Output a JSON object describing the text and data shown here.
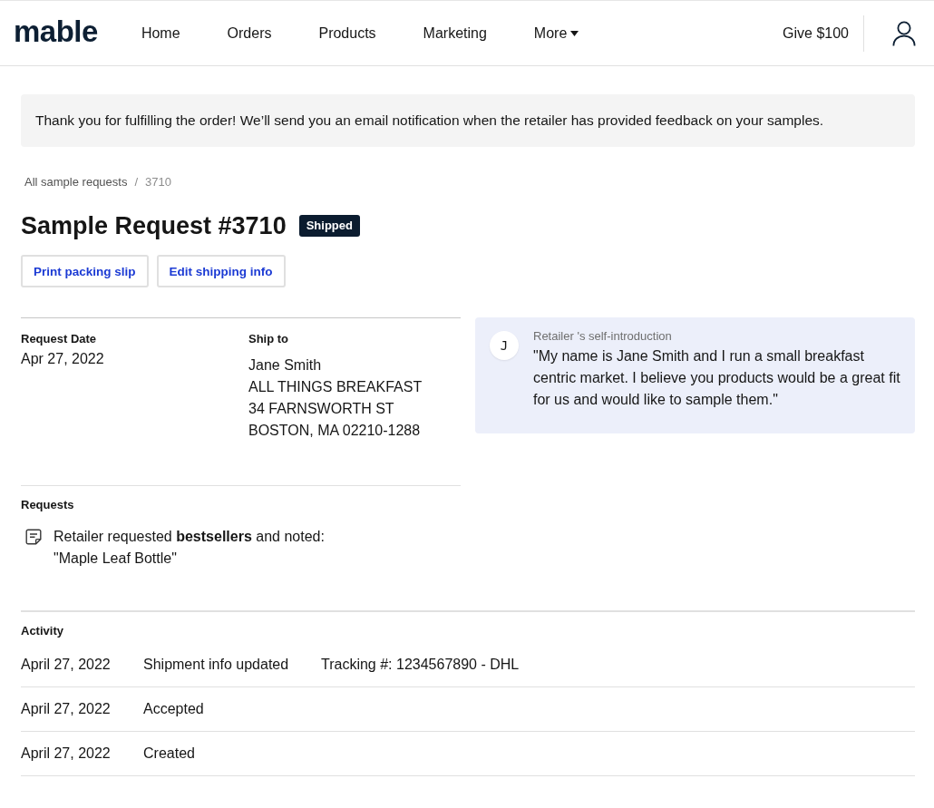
{
  "nav": {
    "logo": "mable",
    "items": [
      {
        "label": "Home",
        "kind": "link",
        "selected": false
      },
      {
        "label": "Orders",
        "kind": "link",
        "selected": false
      },
      {
        "label": "Products",
        "kind": "link",
        "selected": false
      },
      {
        "label": "Marketing",
        "kind": "link",
        "selected": false
      },
      {
        "label": "More",
        "kind": "dropdown",
        "selected": false
      }
    ],
    "give": "Give $100"
  },
  "banner": {
    "text": "Thank you for fulfilling the order! We’ll send you an email notification when the retailer has provided feedback on your samples."
  },
  "breadcrumb": {
    "items": [
      "All sample requests",
      "3710"
    ],
    "separator": "/"
  },
  "title": "Sample Request #3710",
  "status": {
    "label": "Shipped"
  },
  "actions": [
    "Print packing slip",
    "Edit shipping info"
  ],
  "details": {
    "request_date": {
      "label": "Request Date",
      "value": "Apr 27, 2022"
    },
    "ship_to": {
      "label": "Ship to",
      "lines": [
        "Jane Smith",
        "ALL THINGS BREAKFAST",
        "34 FARNSWORTH ST",
        "BOSTON, MA 02210-1288"
      ]
    }
  },
  "introduction": {
    "avatar": "J",
    "label": "Retailer 's self-introduction",
    "text": "\"My name is Jane Smith and I run a small breakfast centric market. I believe you products would be a great fit for us and would like to sample them.\""
  },
  "requests": {
    "label": "Requests",
    "text": "Retailer requested **bestsellers** and noted:",
    "note": "\"Maple Leaf Bottle\""
  },
  "activity": {
    "label": "Activity",
    "rows": [
      {
        "date": "April 27, 2022",
        "event": "Shipment info updated",
        "detail": "Tracking #: 1234567890 - DHL"
      },
      {
        "date": "April 27, 2022",
        "event": "Accepted"
      },
      {
        "date": "April 27, 2022",
        "event": "Created"
      }
    ]
  }
}
